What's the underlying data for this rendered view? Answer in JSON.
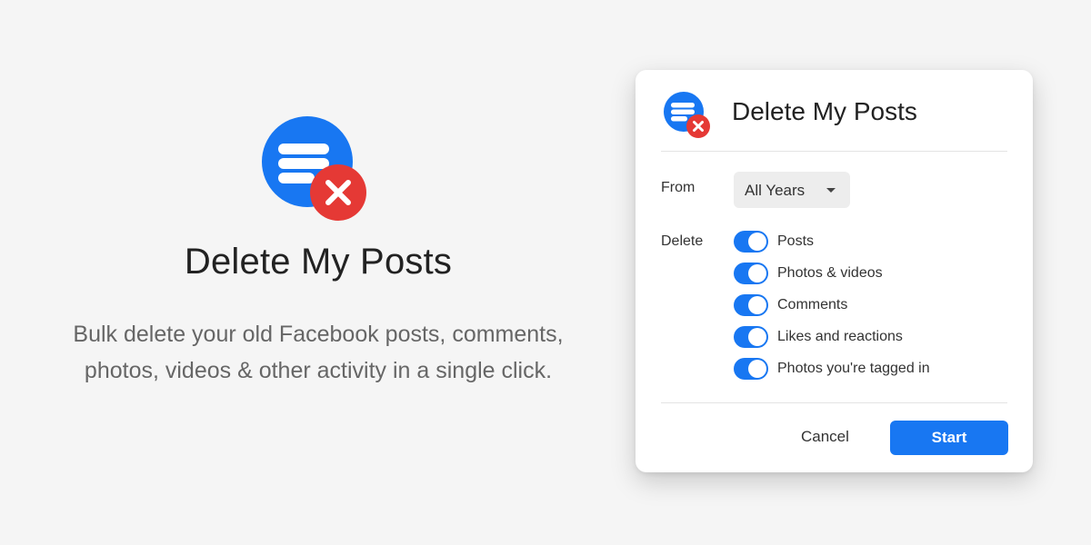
{
  "hero": {
    "title": "Delete My Posts",
    "description_line1": "Bulk delete your old Facebook posts, comments,",
    "description_line2": "photos, videos & other activity in a single click."
  },
  "dialog": {
    "title": "Delete My Posts",
    "from_label": "From",
    "from_value": "All Years",
    "delete_label": "Delete",
    "options": [
      {
        "label": "Posts",
        "enabled": true
      },
      {
        "label": "Photos & videos",
        "enabled": true
      },
      {
        "label": "Comments",
        "enabled": true
      },
      {
        "label": "Likes and reactions",
        "enabled": true
      },
      {
        "label": "Photos you're tagged in",
        "enabled": true
      }
    ],
    "cancel_label": "Cancel",
    "start_label": "Start"
  },
  "colors": {
    "brand_blue": "#1877f2",
    "delete_red": "#e53935",
    "background": "#f5f5f5"
  },
  "icons": {
    "app_logo": "list-with-x-badge-icon",
    "dropdown": "caret-down-icon"
  }
}
